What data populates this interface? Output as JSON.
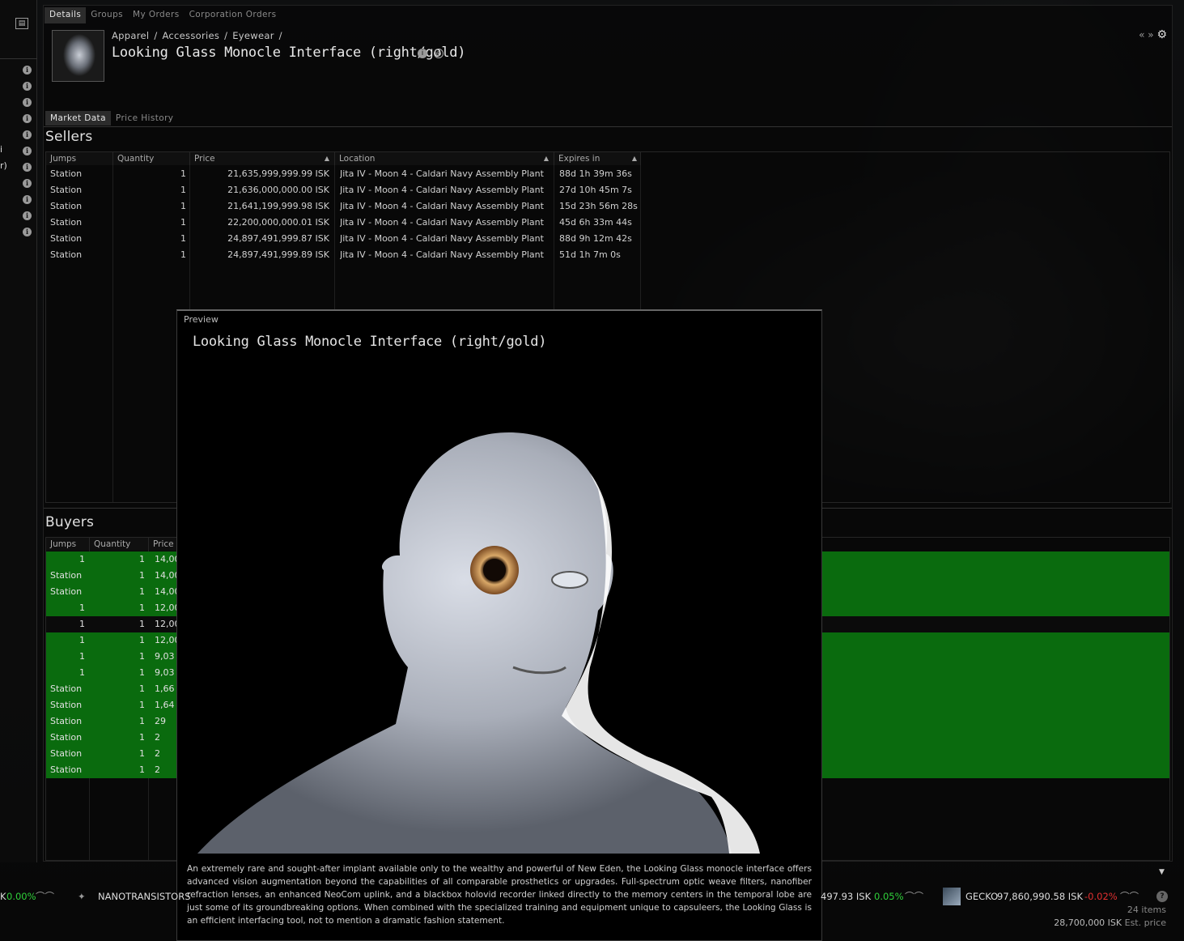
{
  "tabs": [
    "Details",
    "Groups",
    "My Orders",
    "Corporation Orders"
  ],
  "breadcrumb": "Apparel / Accessories / Eyewear /",
  "item_title": "Looking Glass Monocle Interface (right/gold)",
  "top_right": "« »",
  "subtabs": [
    "Market Data",
    "Price History"
  ],
  "sellers": {
    "heading": "Sellers",
    "columns": [
      "Jumps",
      "Quantity",
      "Price",
      "Location",
      "Expires in"
    ],
    "rows": [
      {
        "jumps": "Station",
        "qty": "1",
        "price": "21,635,999,999.99 ISK",
        "loc": "Jita IV - Moon 4 - Caldari Navy Assembly Plant",
        "exp": "88d 1h 39m 36s"
      },
      {
        "jumps": "Station",
        "qty": "1",
        "price": "21,636,000,000.00 ISK",
        "loc": "Jita IV - Moon 4 - Caldari Navy Assembly Plant",
        "exp": "27d 10h 45m 7s"
      },
      {
        "jumps": "Station",
        "qty": "1",
        "price": "21,641,199,999.98 ISK",
        "loc": "Jita IV - Moon 4 - Caldari Navy Assembly Plant",
        "exp": "15d 23h 56m 28s"
      },
      {
        "jumps": "Station",
        "qty": "1",
        "price": "22,200,000,000.01 ISK",
        "loc": "Jita IV - Moon 4 - Caldari Navy Assembly Plant",
        "exp": "45d 6h 33m 44s"
      },
      {
        "jumps": "Station",
        "qty": "1",
        "price": "24,897,491,999.87 ISK",
        "loc": "Jita IV - Moon 4 - Caldari Navy Assembly Plant",
        "exp": "88d 9h 12m 42s"
      },
      {
        "jumps": "Station",
        "qty": "1",
        "price": "24,897,491,999.89 ISK",
        "loc": "Jita IV - Moon 4 - Caldari Navy Assembly Plant",
        "exp": "51d 1h 7m 0s"
      }
    ]
  },
  "buyers": {
    "heading": "Buyers",
    "columns": [
      "Jumps",
      "Quantity",
      "Price"
    ],
    "rows": [
      {
        "jumps": "1",
        "qty": "1",
        "price": "14,00",
        "style": "green"
      },
      {
        "jumps": "Station",
        "qty": "1",
        "price": "14,00",
        "style": "green"
      },
      {
        "jumps": "Station",
        "qty": "1",
        "price": "14,00",
        "style": "green"
      },
      {
        "jumps": "1",
        "qty": "1",
        "price": "12,00",
        "style": "green"
      },
      {
        "jumps": "1",
        "qty": "1",
        "price": "12,00",
        "style": "dark"
      },
      {
        "jumps": "1",
        "qty": "1",
        "price": "12,00",
        "style": "green"
      },
      {
        "jumps": "1",
        "qty": "1",
        "price": "9,03",
        "style": "green"
      },
      {
        "jumps": "1",
        "qty": "1",
        "price": "9,03",
        "style": "green"
      },
      {
        "jumps": "Station",
        "qty": "1",
        "price": "1,66",
        "style": "green"
      },
      {
        "jumps": "Station",
        "qty": "1",
        "price": "1,64",
        "style": "green"
      },
      {
        "jumps": "Station",
        "qty": "1",
        "price": "29",
        "style": "green"
      },
      {
        "jumps": "Station",
        "qty": "1",
        "price": "2",
        "style": "green"
      },
      {
        "jumps": "Station",
        "qty": "1",
        "price": "2",
        "style": "green"
      },
      {
        "jumps": "Station",
        "qty": "1",
        "price": "2",
        "style": "green"
      }
    ]
  },
  "preview": {
    "label": "Preview",
    "name": "Looking Glass Monocle Interface (right/gold)",
    "description": "An extremely rare and sought-after implant available only to the wealthy and powerful of New Eden, the Looking Glass monocle interface offers advanced vision augmentation beyond the capabilities of all comparable prosthetics or upgrades. Full-spectrum optic weave filters, nanofiber refraction lenses, an enhanced NeoCom uplink, and a blackbox holovid recorder linked directly to the memory centers in the temporal lobe are just some of its groundbreaking options. When combined with the specialized training and equipment unique to capsuleers, the Looking Glass is an efficient interfacing tool, not to mention a dramatic fashion statement."
  },
  "left_cut": [
    "i",
    "r)"
  ],
  "ticker": {
    "left_pct": "0.00%",
    "nano": "NANOTRANSISTORS",
    "mid_val": "497.93 ISK",
    "mid_pct": "0.05%",
    "gecko_name": "GECKO",
    "gecko_val": "97,860,990.58 ISK",
    "gecko_pct": "-0.02%",
    "k": "K"
  },
  "footer": {
    "items": "24 items",
    "est_price": "28,700,000 ISK",
    "est_label": "Est. price"
  },
  "colors": {
    "green_row": "#0a6b0e",
    "positive": "#2fd13a",
    "negative": "#e23030"
  }
}
